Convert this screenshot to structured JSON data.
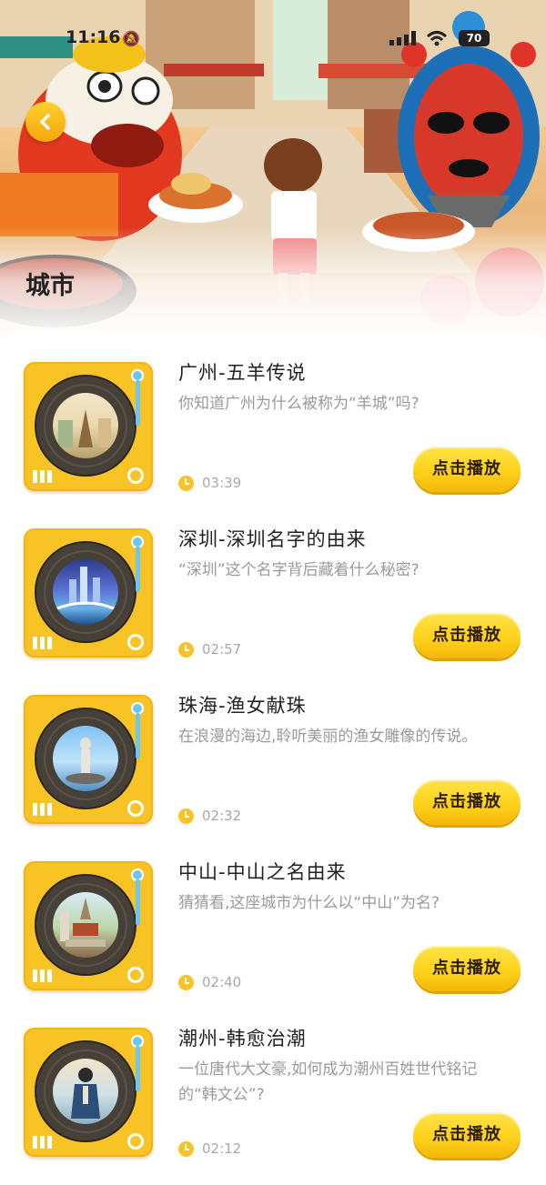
{
  "status_bar": {
    "time": "11:16",
    "battery": "70"
  },
  "header": {
    "title": "城市"
  },
  "play_label": "点击播放",
  "items": [
    {
      "title": "广州-五羊传说",
      "desc": "你知道广州为什么被称为“羊城”吗?",
      "duration": "03:39"
    },
    {
      "title": "深圳-深圳名字的由来",
      "desc": "“深圳”这个名字背后藏着什么秘密?",
      "duration": "02:57"
    },
    {
      "title": "珠海-渔女献珠",
      "desc": "在浪漫的海边,聆听美丽的渔女雕像的传说。",
      "duration": "02:32"
    },
    {
      "title": "中山-中山之名由来",
      "desc": "猜猜看,这座城市为什么以“中山”为名?",
      "duration": "02:40"
    },
    {
      "title": "潮州-韩愈治潮",
      "desc": "一位唐代大文豪,如何成为潮州百姓世代铭记的“韩文公”?",
      "duration": "02:12"
    }
  ],
  "colors": {
    "accent": "#f7c325",
    "title_text": "#222222",
    "desc_text": "#9a9a9a"
  },
  "icons": {
    "back": "chevron-left-icon",
    "clock": "clock-icon",
    "record": "turntable-icon"
  }
}
